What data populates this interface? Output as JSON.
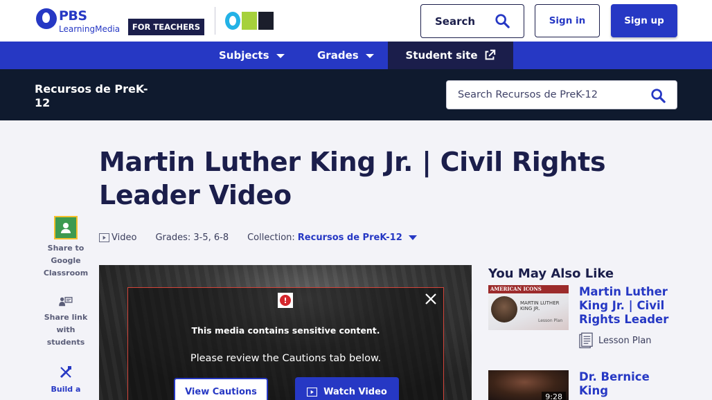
{
  "header": {
    "logo_brand": "PBS",
    "logo_product": "LearningMedia",
    "audience_badge": "FOR TEACHERS",
    "station_logo": "OPB",
    "search_label": "Search",
    "signin_label": "Sign in",
    "signup_label": "Sign up"
  },
  "nav": {
    "subjects": "Subjects",
    "grades": "Grades",
    "student_site": "Student site"
  },
  "collection_bar": {
    "title": "Recursos de PreK-12",
    "search_placeholder": "Search Recursos de PreK-12"
  },
  "resource": {
    "title": "Martin Luther King Jr. | Civil Rights Leader Video",
    "type": "Video",
    "grades": "Grades: 3-5, 6-8",
    "collection_label": "Collection:",
    "collection_name": "Recursos de PreK-12"
  },
  "share": {
    "google_classroom": "Share to Google Classroom",
    "link_students": "Share link with students",
    "build": "Build a"
  },
  "player": {
    "warning_icon": "!",
    "warning_message": "This media contains sensitive content.",
    "warning_sub": "Please review the Cautions tab below.",
    "view_cautions": "View Cautions",
    "watch_video": "Watch Video"
  },
  "related": {
    "heading": "You May Also Like",
    "items": [
      {
        "title": "Martin Luther King Jr. | Civil Rights Leader",
        "type": "Lesson Plan",
        "thumb_banner": "AMERICAN ICONS",
        "thumb_title": "MARTIN LUTHER KING JR.",
        "thumb_caption": "Lesson Plan"
      },
      {
        "title": "Dr. Bernice King",
        "duration": "9:28"
      }
    ]
  },
  "colors": {
    "brand_blue": "#2638c4",
    "navy": "#1b1e4b",
    "collection_bar": "#0f1a2e",
    "warning_red": "#d4262d"
  }
}
